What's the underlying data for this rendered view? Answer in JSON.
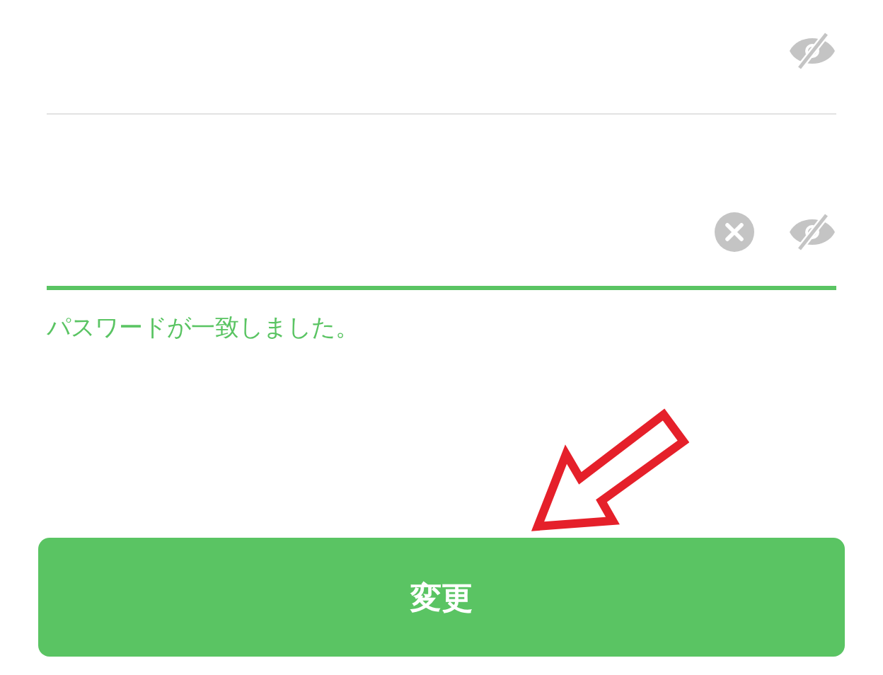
{
  "fields": [
    {
      "focused": false,
      "clear_button": false
    },
    {
      "focused": true,
      "clear_button": true
    }
  ],
  "message": "パスワードが一致しました。",
  "button": {
    "label": "変更"
  }
}
